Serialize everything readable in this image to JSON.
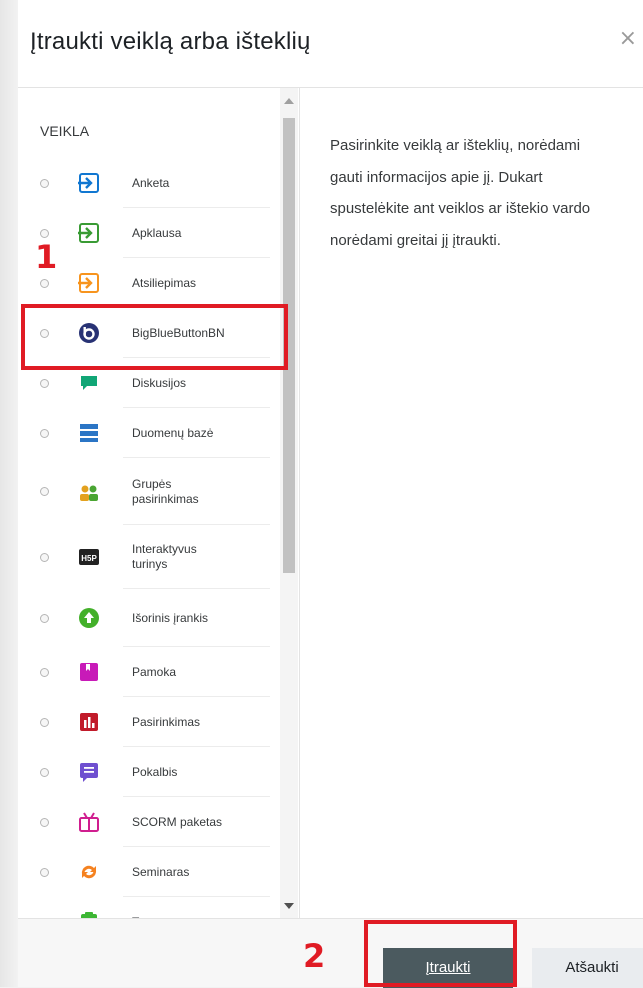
{
  "dialog": {
    "title": "Įtraukti veiklą arba išteklių",
    "close_glyph": "×"
  },
  "section": {
    "label": "VEIKLA"
  },
  "items": [
    {
      "label": "Anketa",
      "icon": "feedback-icon",
      "color": "#1177d1"
    },
    {
      "label": "Apklausa",
      "icon": "choice-icon",
      "color": "#399b34"
    },
    {
      "label": "Atsiliepimas",
      "icon": "feedback-icon",
      "color": "#f7941e"
    },
    {
      "label": "BigBlueButtonBN",
      "icon": "bigbluebutton-icon",
      "color": "#283274"
    },
    {
      "label": "Diskusijos",
      "icon": "forum-icon",
      "color": "#11a676"
    },
    {
      "label": "Duomenų bazė",
      "icon": "database-icon",
      "color": "#2b75c5"
    },
    {
      "label": "Grupės pasirinkimas",
      "icon": "group-choice-icon",
      "color": "#e3a11e"
    },
    {
      "label": "Interaktyvus turinys",
      "icon": "h5p-icon",
      "color": "#222222"
    },
    {
      "label": "Išorinis įrankis",
      "icon": "lti-icon",
      "color": "#43b02a"
    },
    {
      "label": "Pamoka",
      "icon": "lesson-icon",
      "color": "#c81ab8"
    },
    {
      "label": "Pasirinkimas",
      "icon": "poll-icon",
      "color": "#c11b2a"
    },
    {
      "label": "Pokalbis",
      "icon": "chat-icon",
      "color": "#6f4fd0"
    },
    {
      "label": "SCORM paketas",
      "icon": "scorm-icon",
      "color": "#d01e8f"
    },
    {
      "label": "Seminaras",
      "icon": "workshop-icon",
      "color": "#f58220"
    },
    {
      "label": "Testas",
      "icon": "quiz-icon",
      "color": "#3db634"
    }
  ],
  "description": "Pasirinkite veiklą ar išteklių, norėdami gauti informacijos apie jį. Dukart spustelėkite ant veiklos ar ištekio vardo norėdami greitai jį įtraukti.",
  "footer": {
    "add_label": "Įtraukti",
    "cancel_label": "Atšaukti"
  },
  "annotations": {
    "marker1": "1",
    "marker2": "2",
    "color": "#e01b24"
  }
}
